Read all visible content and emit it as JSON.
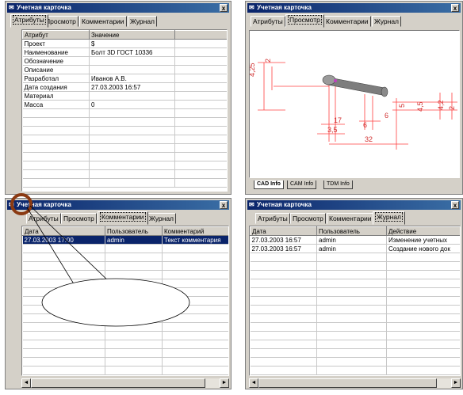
{
  "window_title": "Учетная карточка",
  "close_glyph": "x",
  "icon_glyph": "✉",
  "tabs": [
    "Атрибуты",
    "Просмотр",
    "Комментарии",
    "Журнал"
  ],
  "attributes": {
    "headers": [
      "Атрибут",
      "Значение"
    ],
    "rows": [
      [
        "Проект",
        "$"
      ],
      [
        "Наименование",
        "Болт 3D ГОСТ 10336"
      ],
      [
        "Обозначение",
        ""
      ],
      [
        "Описание",
        ""
      ],
      [
        "Разработал",
        "Иванов А.В."
      ],
      [
        "Дата создания",
        "27.03.2003 16:57"
      ],
      [
        "Материал",
        ""
      ],
      [
        "Масса",
        "0"
      ]
    ]
  },
  "preview": {
    "bottom_tabs": [
      "CAD Info",
      "CAM Info",
      "TDM Info"
    ],
    "dims": [
      "4,25",
      "2",
      "17",
      "6",
      "6",
      "5",
      "32",
      "3,5",
      "4,5",
      "4,2",
      "2"
    ]
  },
  "comments": {
    "headers": [
      "Дата",
      "Пользователь",
      "Комментарий"
    ],
    "rows": [
      [
        "27.03.2003 17:00",
        "admin",
        "Текст комментария"
      ]
    ]
  },
  "journal": {
    "headers": [
      "Дата",
      "Пользователь",
      "Действие"
    ],
    "rows": [
      [
        "27.03.2003 16:57",
        "admin",
        "Изменение учетных"
      ],
      [
        "27.03.2003 16:57",
        "admin",
        "Создание нового док"
      ]
    ]
  },
  "colors": {
    "titlebar": "#0a246a",
    "selection": "#0a246a",
    "annotation_circle": "#8b3a12",
    "drawing_lines": "#ff4040"
  },
  "scroll_glyphs": {
    "left": "◄",
    "right": "►"
  }
}
